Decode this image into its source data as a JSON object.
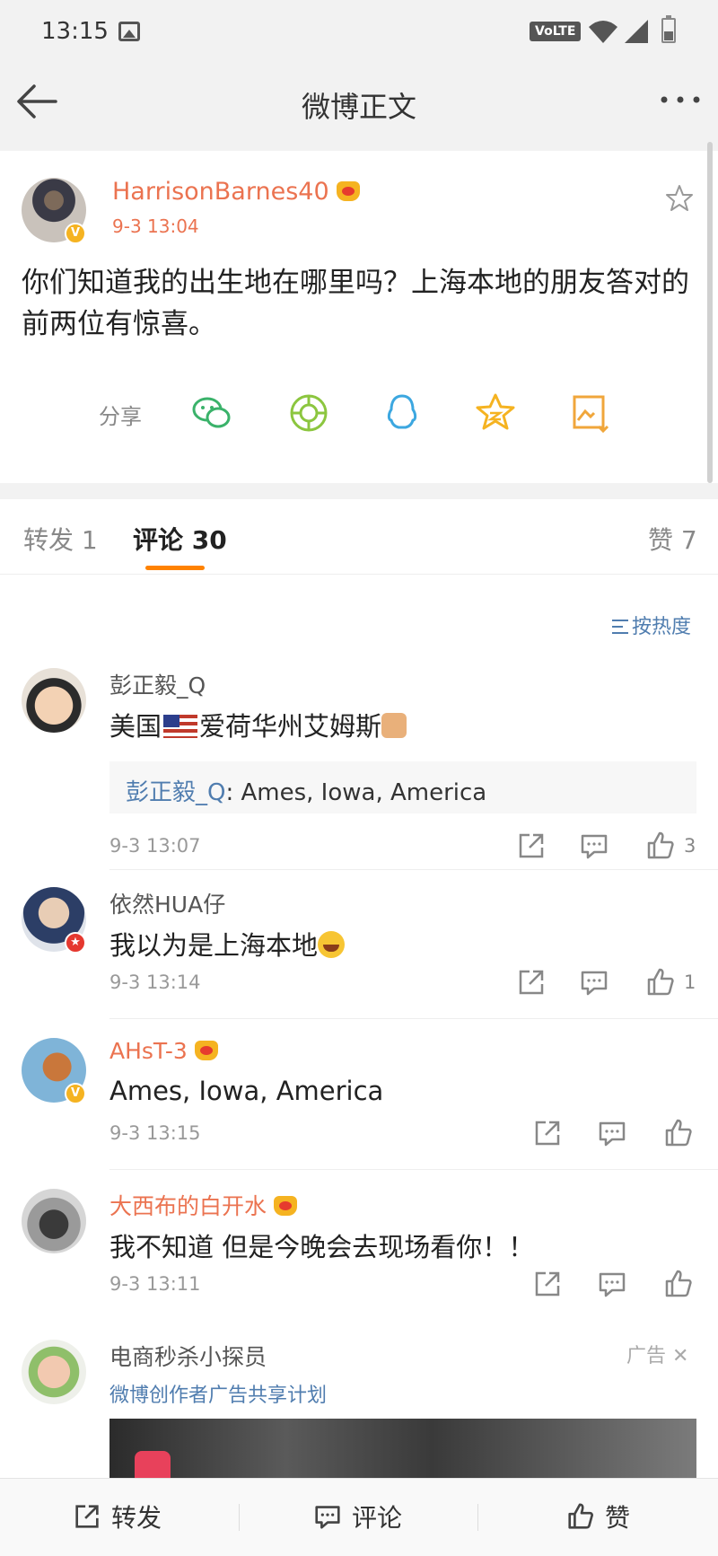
{
  "status_bar": {
    "time": "13:15",
    "volte": "VoLTE"
  },
  "nav": {
    "title": "微博正文"
  },
  "post": {
    "username": "HarrisonBarnes40",
    "time": "9-3 13:04",
    "text": "你们知道我的出生地在哪里吗？上海本地的朋友答对的前两位有惊喜。",
    "share_label": "分享",
    "share_icons": [
      "wechat-icon",
      "moments-icon",
      "qq-icon",
      "qzone-icon",
      "save-image-icon"
    ]
  },
  "tabs": {
    "repost": "转发 1",
    "comment": "评论 30",
    "like": "赞 7"
  },
  "sort_label": "按热度",
  "comments": [
    {
      "name": "彭正毅_Q",
      "text_a": "美国",
      "text_b": "爱荷华州艾姆斯",
      "reply_name": "彭正毅_Q",
      "reply_text": ": Ames, Iowa, America",
      "time": "9-3 13:07",
      "likes": "3"
    },
    {
      "name": "依然HUA仔",
      "text": "我以为是上海本地",
      "time": "9-3 13:14",
      "likes": "1"
    },
    {
      "name": "AHsT-3",
      "text": "Ames, Iowa, America",
      "time": "9-3 13:15"
    },
    {
      "name": "大西布的白开水",
      "text": "我不知道 但是今晚会去现场看你！！",
      "time": "9-3 13:11"
    }
  ],
  "ad": {
    "name": "电商秒杀小探员",
    "tag": "广告",
    "subtitle": "微博创作者广告共享计划"
  },
  "bottom_bar": {
    "repost": "转发",
    "comment": "评论",
    "like": "赞"
  },
  "colors": {
    "accent_orange": "#ff8200",
    "vip_name": "#eb7350",
    "link_blue": "#507daf"
  }
}
